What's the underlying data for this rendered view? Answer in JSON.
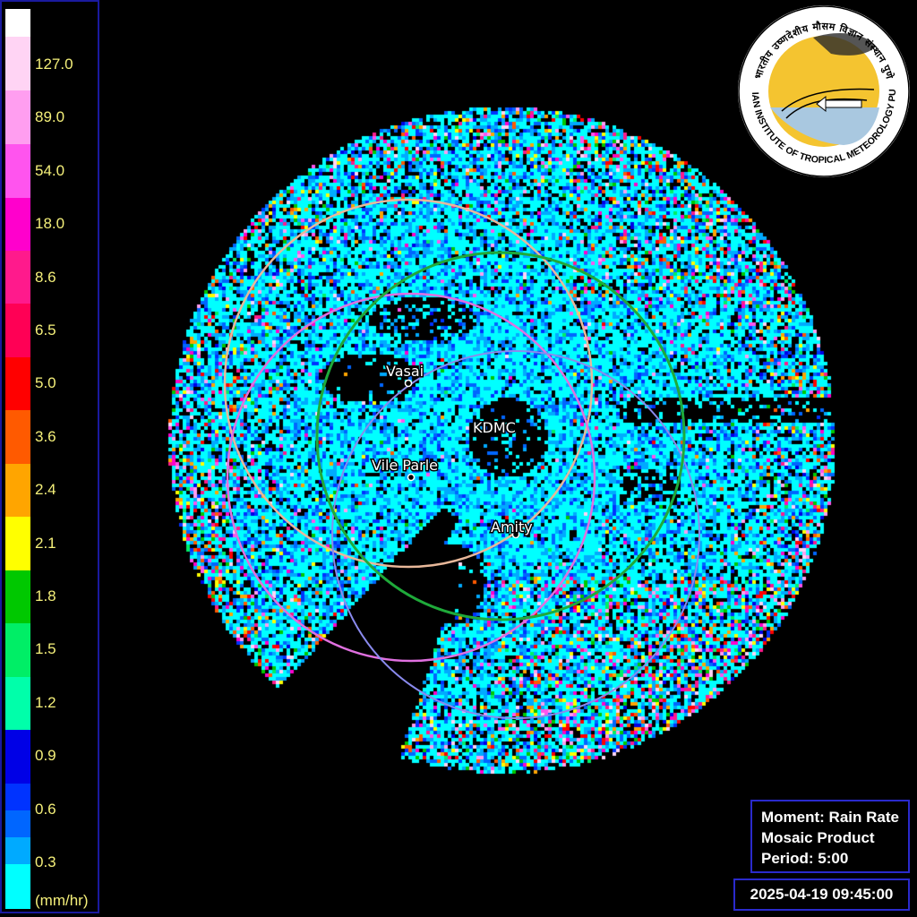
{
  "legend": {
    "unit": "(mm/hr)",
    "bins": [
      {
        "color": "#ffffff",
        "label": ""
      },
      {
        "color": "#ffd4f4",
        "label": "127.0"
      },
      {
        "color": "#ff9ef0",
        "label": "89.0"
      },
      {
        "color": "#ff54ee",
        "label": "54.0"
      },
      {
        "color": "#ff00cc",
        "label": "18.0"
      },
      {
        "color": "#ff1a8c",
        "label": "8.6"
      },
      {
        "color": "#ff0055",
        "label": "6.5"
      },
      {
        "color": "#ff0000",
        "label": "5.0"
      },
      {
        "color": "#ff5a00",
        "label": "3.6"
      },
      {
        "color": "#ffa500",
        "label": "2.4"
      },
      {
        "color": "#ffff00",
        "label": "2.1"
      },
      {
        "color": "#00c800",
        "label": "1.8"
      },
      {
        "color": "#00ee66",
        "label": "1.5"
      },
      {
        "color": "#00ffaa",
        "label": "1.2"
      },
      {
        "color": "#0000e6",
        "label": "0.9"
      },
      {
        "color": "#0033ff",
        "label": "0.6"
      },
      {
        "color": "#0066ff",
        "label": "0.3"
      },
      {
        "color": "#00aaff",
        "label": ""
      },
      {
        "color": "#00ffff",
        "label": ""
      }
    ]
  },
  "stations": [
    {
      "name": "Vasai"
    },
    {
      "name": "KDMC"
    },
    {
      "name": "Vile Parle"
    },
    {
      "name": "Amity"
    }
  ],
  "logo": {
    "text_top": "भारतीय उष्णदेशीय मौसम विज्ञान संस्थान पुणे",
    "text_bottom": "INDIAN INSTITUTE OF TROPICAL METEOROLOGY PUNE"
  },
  "info": {
    "moment": "Moment: Rain Rate",
    "product": "Mosaic Product",
    "period": "Period: 5:00"
  },
  "timestamp": "2025-04-19 09:45:00",
  "colors": {
    "background": "#000000",
    "legend_border": "#1a1a9e",
    "legend_text": "#f5f07a",
    "box_border": "#2a2acc",
    "ring_vasai": "#e8b89a",
    "ring_kdmc": "#1faa3a",
    "ring_vileparle": "#e070e0",
    "ring_amity": "#8a8aee"
  }
}
